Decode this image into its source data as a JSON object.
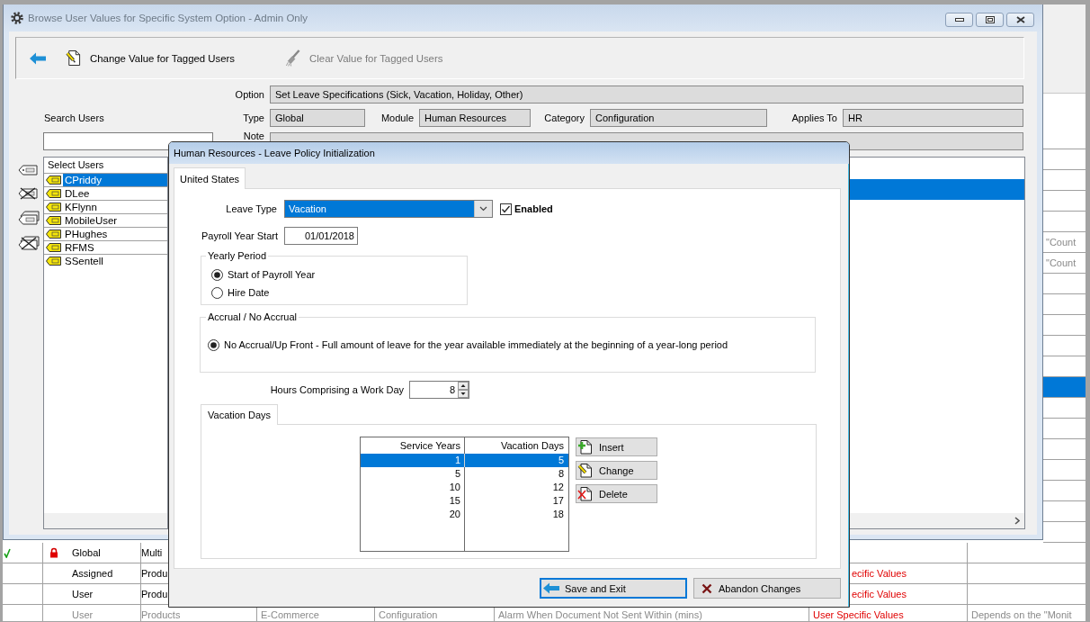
{
  "background_table": {
    "rows_behind_window": [
      {
        "selected": false
      },
      {
        "selected": false
      },
      {
        "selected": false
      },
      {
        "selected": false
      },
      {
        "selected": false
      },
      {
        "selected": false,
        "column_8": "\"Count"
      },
      {
        "selected": false,
        "column_8": "\"Count"
      },
      {
        "selected": false
      },
      {
        "selected": false
      },
      {
        "selected": false
      },
      {
        "selected": false
      },
      {
        "selected": false
      },
      {
        "selected": true
      },
      {
        "selected": false
      },
      {
        "selected": false
      },
      {
        "selected": false
      },
      {
        "selected": false
      },
      {
        "selected": false
      },
      {
        "selected": false
      },
      {
        "selected": false
      }
    ],
    "rows": [
      {
        "selected": false,
        "checked": true,
        "locked": true,
        "dimmed": false,
        "column_2": "Global",
        "column_3": "Multi"
      },
      {
        "selected": false,
        "checked": false,
        "locked": false,
        "dimmed": false,
        "column_2": "Assigned",
        "column_3": "Produ",
        "column_7": "ecific Values"
      },
      {
        "selected": false,
        "checked": false,
        "locked": false,
        "dimmed": false,
        "column_2": "User",
        "column_3": "Produ",
        "column_7": "ecific Values"
      },
      {
        "selected": false,
        "checked": false,
        "locked": false,
        "dimmed": true,
        "column_2": "User",
        "column_3": "Products",
        "column_4": "E-Commerce",
        "column_5": "Configuration",
        "column_6": "Alarm When Document Not Sent Within (mins)",
        "column_7": "User Specific Values",
        "column_8": "Depends on the \"Monit"
      }
    ]
  },
  "browse_window": {
    "active": false,
    "title": "Browse User Values for Specific System Option - Admin Only",
    "toolbar": [
      {
        "kind": "back",
        "disabled": false
      },
      {
        "kind": "edit",
        "label": "Change Value for Tagged Users",
        "disabled": false
      },
      {
        "kind": "clear",
        "label": "Clear Value for Tagged Users",
        "disabled": true
      }
    ],
    "option": {
      "label": "Option",
      "value": "Set Leave Specifications (Sick, Vacation, Holiday, Other)"
    },
    "search": {
      "label": "Search Users"
    },
    "type": {
      "label": "Type",
      "value": "Global"
    },
    "module": {
      "label": "Module",
      "value": "Human Resources"
    },
    "category": {
      "label": "Category",
      "value": "Configuration"
    },
    "applies_to": {
      "label": "Applies To",
      "value": "HR"
    },
    "note": {
      "label": "Note"
    },
    "user_list": {
      "header": "Select Users",
      "items": [
        {
          "name": "CPriddy",
          "selected": true
        },
        {
          "name": "DLee",
          "selected": false
        },
        {
          "name": "KFlynn",
          "selected": false
        },
        {
          "name": "MobileUser",
          "selected": false
        },
        {
          "name": "PHughes",
          "selected": false
        },
        {
          "name": "RFMS",
          "selected": false
        },
        {
          "name": "SSentell",
          "selected": false
        }
      ]
    },
    "values_grid": {
      "rows": [
        {
          "selected": true
        }
      ]
    }
  },
  "dialog": {
    "active": true,
    "title": "Human Resources - Leave Policy Initialization",
    "tabs": [
      {
        "label": "United States",
        "selected": true
      }
    ],
    "leave_type": {
      "label": "Leave Type",
      "value": "Vacation",
      "focused": true
    },
    "enabled": {
      "label": "Enabled",
      "checked": true
    },
    "payroll_year_start": {
      "label": "Payroll Year Start",
      "value": "01/01/2018"
    },
    "yearly_period": {
      "title": "Yearly Period",
      "options": [
        {
          "label": "Start of Payroll Year",
          "selected": true
        },
        {
          "label": "Hire Date",
          "selected": false
        }
      ]
    },
    "accrual": {
      "title": "Accrual / No Accrual",
      "options": [
        {
          "label": "No Accrual/Up Front - Full amount of leave for the year available immediately at the beginning of a year-long period",
          "selected": true
        }
      ]
    },
    "hours_per_day": {
      "label": "Hours Comprising a Work Day",
      "value": "8"
    },
    "detail_tabs": [
      {
        "label": "Vacation Days",
        "selected": true
      }
    ],
    "vacation_table": {
      "columns": [
        "Service Years",
        "Vacation Days"
      ],
      "rows": [
        {
          "cells": [
            "1",
            "5"
          ],
          "selected": true
        },
        {
          "cells": [
            "5",
            "8"
          ],
          "selected": false
        },
        {
          "cells": [
            "10",
            "12"
          ],
          "selected": false
        },
        {
          "cells": [
            "15",
            "17"
          ],
          "selected": false
        },
        {
          "cells": [
            "20",
            "18"
          ],
          "selected": false
        }
      ]
    },
    "table_buttons": [
      {
        "kind": "insert",
        "label": "Insert"
      },
      {
        "kind": "change",
        "label": "Change"
      },
      {
        "kind": "delete",
        "label": "Delete"
      }
    ],
    "footer_buttons": [
      {
        "kind": "save",
        "label": "Save and Exit",
        "default": true
      },
      {
        "kind": "abandon",
        "label": "Abandon Changes",
        "default": false
      }
    ]
  }
}
